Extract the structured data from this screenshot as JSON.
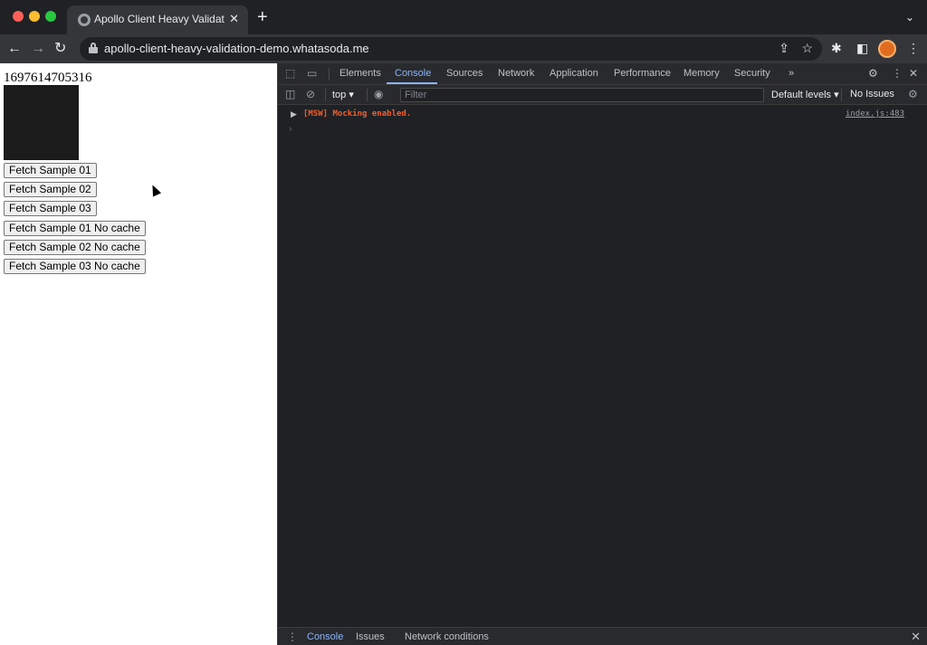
{
  "browser": {
    "tab_title": "Apollo Client Heavy Validation",
    "tab_close": "✕",
    "new_tab": "+",
    "tab_menu": "⌄",
    "url": "apollo-client-heavy-validation-demo.whatasoda.me",
    "nav": {
      "back": "←",
      "forward": "→",
      "reload": "↻"
    },
    "icons": {
      "share": "⇪",
      "star": "☆",
      "extensions": "✱",
      "sidepanel": "◧",
      "menu": "⋮"
    }
  },
  "page": {
    "timestamp": "1697614705316",
    "buttons": [
      {
        "label": "Fetch Sample 01"
      },
      {
        "label": "Fetch Sample 02"
      },
      {
        "label": "Fetch Sample 03"
      },
      {
        "label": "Fetch Sample 01 No cache"
      },
      {
        "label": "Fetch Sample 02 No cache"
      },
      {
        "label": "Fetch Sample 03 No cache"
      }
    ]
  },
  "devtools": {
    "icons": {
      "inspect": "⬚",
      "device": "▭",
      "settings": "⚙",
      "more": "⋮",
      "close": "✕",
      "sidebar": "◫",
      "clear": "⊘",
      "eye": "◉",
      "console_settings": "⚙"
    },
    "tabs": [
      {
        "label": "Elements"
      },
      {
        "label": "Console"
      },
      {
        "label": "Sources"
      },
      {
        "label": "Network"
      },
      {
        "label": "Application"
      },
      {
        "label": "Performance"
      },
      {
        "label": "Memory"
      },
      {
        "label": "Security"
      },
      {
        "label": "»"
      }
    ],
    "active_tab": "Console",
    "console": {
      "context": "top ▾",
      "filter_placeholder": "Filter",
      "levels": "Default levels ▾",
      "issues": "No Issues",
      "message": {
        "caret": "▶",
        "text": "[MSW] Mocking enabled.",
        "source": "index.js:483"
      },
      "prompt": "›"
    },
    "drawer": {
      "menu": "⋮",
      "tabs": [
        {
          "label": "Console"
        },
        {
          "label": "Issues"
        },
        {
          "label": "Network conditions"
        }
      ],
      "close": "✕"
    }
  }
}
